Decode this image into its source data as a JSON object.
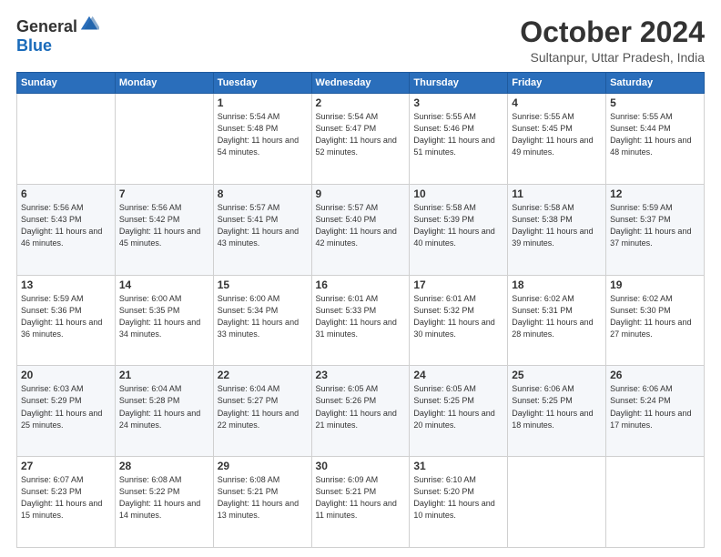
{
  "header": {
    "logo": {
      "general": "General",
      "blue": "Blue"
    },
    "title": "October 2024",
    "location": "Sultanpur, Uttar Pradesh, India"
  },
  "days_of_week": [
    "Sunday",
    "Monday",
    "Tuesday",
    "Wednesday",
    "Thursday",
    "Friday",
    "Saturday"
  ],
  "weeks": [
    [
      {
        "day": "",
        "content": ""
      },
      {
        "day": "",
        "content": ""
      },
      {
        "day": "1",
        "content": "Sunrise: 5:54 AM\nSunset: 5:48 PM\nDaylight: 11 hours and 54 minutes."
      },
      {
        "day": "2",
        "content": "Sunrise: 5:54 AM\nSunset: 5:47 PM\nDaylight: 11 hours and 52 minutes."
      },
      {
        "day": "3",
        "content": "Sunrise: 5:55 AM\nSunset: 5:46 PM\nDaylight: 11 hours and 51 minutes."
      },
      {
        "day": "4",
        "content": "Sunrise: 5:55 AM\nSunset: 5:45 PM\nDaylight: 11 hours and 49 minutes."
      },
      {
        "day": "5",
        "content": "Sunrise: 5:55 AM\nSunset: 5:44 PM\nDaylight: 11 hours and 48 minutes."
      }
    ],
    [
      {
        "day": "6",
        "content": "Sunrise: 5:56 AM\nSunset: 5:43 PM\nDaylight: 11 hours and 46 minutes."
      },
      {
        "day": "7",
        "content": "Sunrise: 5:56 AM\nSunset: 5:42 PM\nDaylight: 11 hours and 45 minutes."
      },
      {
        "day": "8",
        "content": "Sunrise: 5:57 AM\nSunset: 5:41 PM\nDaylight: 11 hours and 43 minutes."
      },
      {
        "day": "9",
        "content": "Sunrise: 5:57 AM\nSunset: 5:40 PM\nDaylight: 11 hours and 42 minutes."
      },
      {
        "day": "10",
        "content": "Sunrise: 5:58 AM\nSunset: 5:39 PM\nDaylight: 11 hours and 40 minutes."
      },
      {
        "day": "11",
        "content": "Sunrise: 5:58 AM\nSunset: 5:38 PM\nDaylight: 11 hours and 39 minutes."
      },
      {
        "day": "12",
        "content": "Sunrise: 5:59 AM\nSunset: 5:37 PM\nDaylight: 11 hours and 37 minutes."
      }
    ],
    [
      {
        "day": "13",
        "content": "Sunrise: 5:59 AM\nSunset: 5:36 PM\nDaylight: 11 hours and 36 minutes."
      },
      {
        "day": "14",
        "content": "Sunrise: 6:00 AM\nSunset: 5:35 PM\nDaylight: 11 hours and 34 minutes."
      },
      {
        "day": "15",
        "content": "Sunrise: 6:00 AM\nSunset: 5:34 PM\nDaylight: 11 hours and 33 minutes."
      },
      {
        "day": "16",
        "content": "Sunrise: 6:01 AM\nSunset: 5:33 PM\nDaylight: 11 hours and 31 minutes."
      },
      {
        "day": "17",
        "content": "Sunrise: 6:01 AM\nSunset: 5:32 PM\nDaylight: 11 hours and 30 minutes."
      },
      {
        "day": "18",
        "content": "Sunrise: 6:02 AM\nSunset: 5:31 PM\nDaylight: 11 hours and 28 minutes."
      },
      {
        "day": "19",
        "content": "Sunrise: 6:02 AM\nSunset: 5:30 PM\nDaylight: 11 hours and 27 minutes."
      }
    ],
    [
      {
        "day": "20",
        "content": "Sunrise: 6:03 AM\nSunset: 5:29 PM\nDaylight: 11 hours and 25 minutes."
      },
      {
        "day": "21",
        "content": "Sunrise: 6:04 AM\nSunset: 5:28 PM\nDaylight: 11 hours and 24 minutes."
      },
      {
        "day": "22",
        "content": "Sunrise: 6:04 AM\nSunset: 5:27 PM\nDaylight: 11 hours and 22 minutes."
      },
      {
        "day": "23",
        "content": "Sunrise: 6:05 AM\nSunset: 5:26 PM\nDaylight: 11 hours and 21 minutes."
      },
      {
        "day": "24",
        "content": "Sunrise: 6:05 AM\nSunset: 5:25 PM\nDaylight: 11 hours and 20 minutes."
      },
      {
        "day": "25",
        "content": "Sunrise: 6:06 AM\nSunset: 5:25 PM\nDaylight: 11 hours and 18 minutes."
      },
      {
        "day": "26",
        "content": "Sunrise: 6:06 AM\nSunset: 5:24 PM\nDaylight: 11 hours and 17 minutes."
      }
    ],
    [
      {
        "day": "27",
        "content": "Sunrise: 6:07 AM\nSunset: 5:23 PM\nDaylight: 11 hours and 15 minutes."
      },
      {
        "day": "28",
        "content": "Sunrise: 6:08 AM\nSunset: 5:22 PM\nDaylight: 11 hours and 14 minutes."
      },
      {
        "day": "29",
        "content": "Sunrise: 6:08 AM\nSunset: 5:21 PM\nDaylight: 11 hours and 13 minutes."
      },
      {
        "day": "30",
        "content": "Sunrise: 6:09 AM\nSunset: 5:21 PM\nDaylight: 11 hours and 11 minutes."
      },
      {
        "day": "31",
        "content": "Sunrise: 6:10 AM\nSunset: 5:20 PM\nDaylight: 11 hours and 10 minutes."
      },
      {
        "day": "",
        "content": ""
      },
      {
        "day": "",
        "content": ""
      }
    ]
  ]
}
